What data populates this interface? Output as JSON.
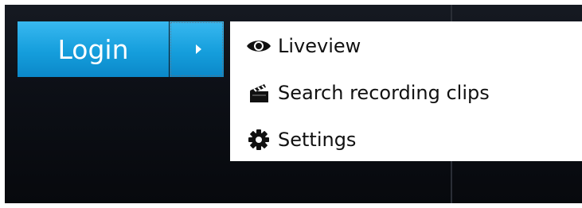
{
  "login_button": {
    "label": "Login"
  },
  "dropdown": {
    "items": [
      {
        "label": "Liveview",
        "icon": "eye-icon"
      },
      {
        "label": "Search recording clips",
        "icon": "clapperboard-icon"
      },
      {
        "label": "Settings",
        "icon": "gear-icon"
      }
    ]
  },
  "colors": {
    "button_blue": "#159edc",
    "background_dark": "#0d1017",
    "menu_background": "#ffffff",
    "menu_text": "#111111"
  }
}
